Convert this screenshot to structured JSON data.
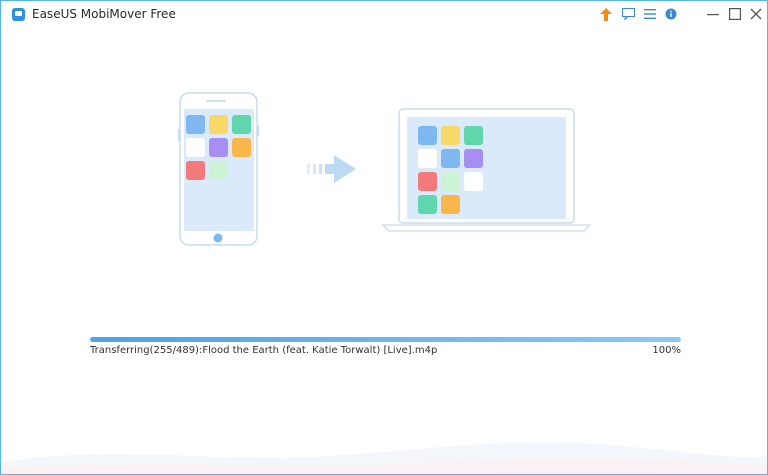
{
  "window": {
    "title": "EaseUS MobiMover Free"
  },
  "toolbar": {
    "upgrade_icon": "arrow-up-icon",
    "feedback_icon": "chat-icon",
    "menu_icon": "hamburger-icon",
    "info_icon": "info-icon"
  },
  "window_controls": {
    "minimize": "minimize-icon",
    "maximize": "maximize-icon",
    "close": "close-icon"
  },
  "transfer": {
    "status_text": "Transferring(255/489):Flood the Earth (feat. Katie Torwalt) [Live].m4p",
    "percent_label": "100%",
    "progress": 1.0
  },
  "colors": {
    "accent": "#3e88d3",
    "upgrade": "#f08a1a",
    "tile_blue": "#7fb8f0",
    "tile_yellow": "#f8d866",
    "tile_green": "#5fd6ac",
    "tile_purple": "#a78ef2",
    "tile_orange": "#f8b64b",
    "tile_red": "#f27a7a",
    "tile_lightgreen": "#ccf3d4",
    "tile_white": "#ffffff"
  }
}
